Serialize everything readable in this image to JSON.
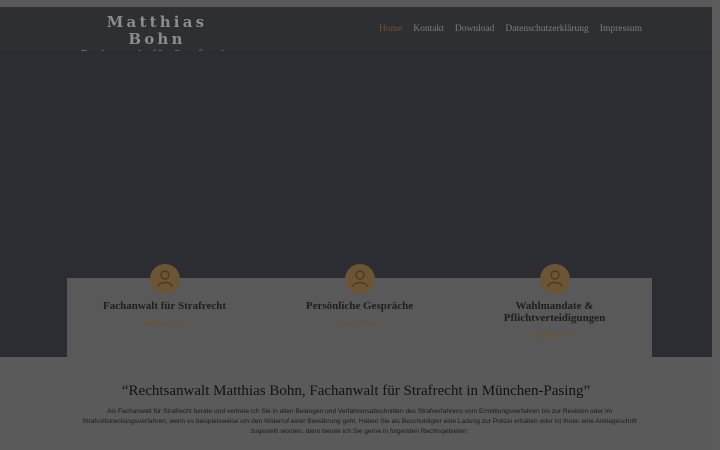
{
  "header": {
    "logo_name": "Matthias Bohn",
    "logo_subtitle": "Fachanwalt für Strafrecht"
  },
  "nav": {
    "items": [
      {
        "label": "Home",
        "active": true
      },
      {
        "label": "Kontakt",
        "active": false
      },
      {
        "label": "Download",
        "active": false
      },
      {
        "label": "Datenschutzerklärung",
        "active": false
      },
      {
        "label": "Impressum",
        "active": false
      }
    ]
  },
  "features": [
    {
      "title": "Fachanwalt für Strafrecht",
      "author": "Matthias Bohn",
      "icon": "user-icon"
    },
    {
      "title": "Persönliche Gespräche",
      "author": "Matthias Bohn",
      "icon": "user-icon"
    },
    {
      "title": "Wahlmandate & Pflichtverteidigungen",
      "author": "Matthias Bohn",
      "icon": "user-icon"
    }
  ],
  "intro": {
    "heading": "“Rechtsanwalt Matthias Bohn, Fachanwalt für Strafrecht in München-Pasing”",
    "text": "Als Fachanwalt für Strafrecht berate und vertrete ich Sie in allen Belangen und Verfahrensabschnitten des Strafverfahrens vom Ermittlungsverfahren bis zur Revision oder im Strafvollstreckungsverfahren, wenn es beispielsweise um den Widerruf einer Bewährung geht. Haben Sie als Beschuldigter eine Ladung zur Polizei erhalten oder ist Ihnen eine Anklageschrift zugestellt worden, dann berate ich Sie gerne in folgenden Rechtsgebieten:"
  },
  "colors": {
    "header_bg": "#2e2f33",
    "hero_bg": "#2b2d32",
    "accent": "#6c5535",
    "overlay_gray": "#5a5a5a"
  }
}
